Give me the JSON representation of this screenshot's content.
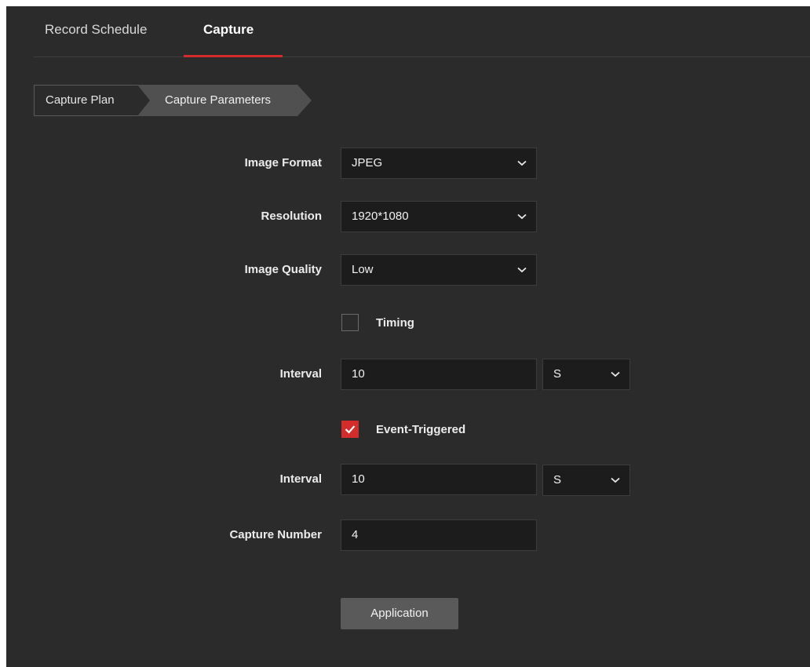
{
  "tabs": [
    {
      "label": "Record Schedule",
      "active": false
    },
    {
      "label": "Capture",
      "active": true
    }
  ],
  "steps": {
    "plan": "Capture Plan",
    "parameters": "Capture Parameters"
  },
  "form": {
    "image_format": {
      "label": "Image Format",
      "value": "JPEG"
    },
    "resolution": {
      "label": "Resolution",
      "value": "1920*1080"
    },
    "image_quality": {
      "label": "Image Quality",
      "value": "Low"
    },
    "timing": {
      "label": "Timing",
      "checked": false
    },
    "timing_interval": {
      "label": "Interval",
      "value": "10",
      "unit": "S"
    },
    "event_triggered": {
      "label": "Event-Triggered",
      "checked": true
    },
    "event_interval": {
      "label": "Interval",
      "value": "10",
      "unit": "S"
    },
    "capture_number": {
      "label": "Capture Number",
      "value": "4"
    }
  },
  "buttons": {
    "apply": "Application"
  },
  "colors": {
    "accent": "#d42b2b",
    "background": "#2b2b2b",
    "field": "#1c1c1c"
  }
}
